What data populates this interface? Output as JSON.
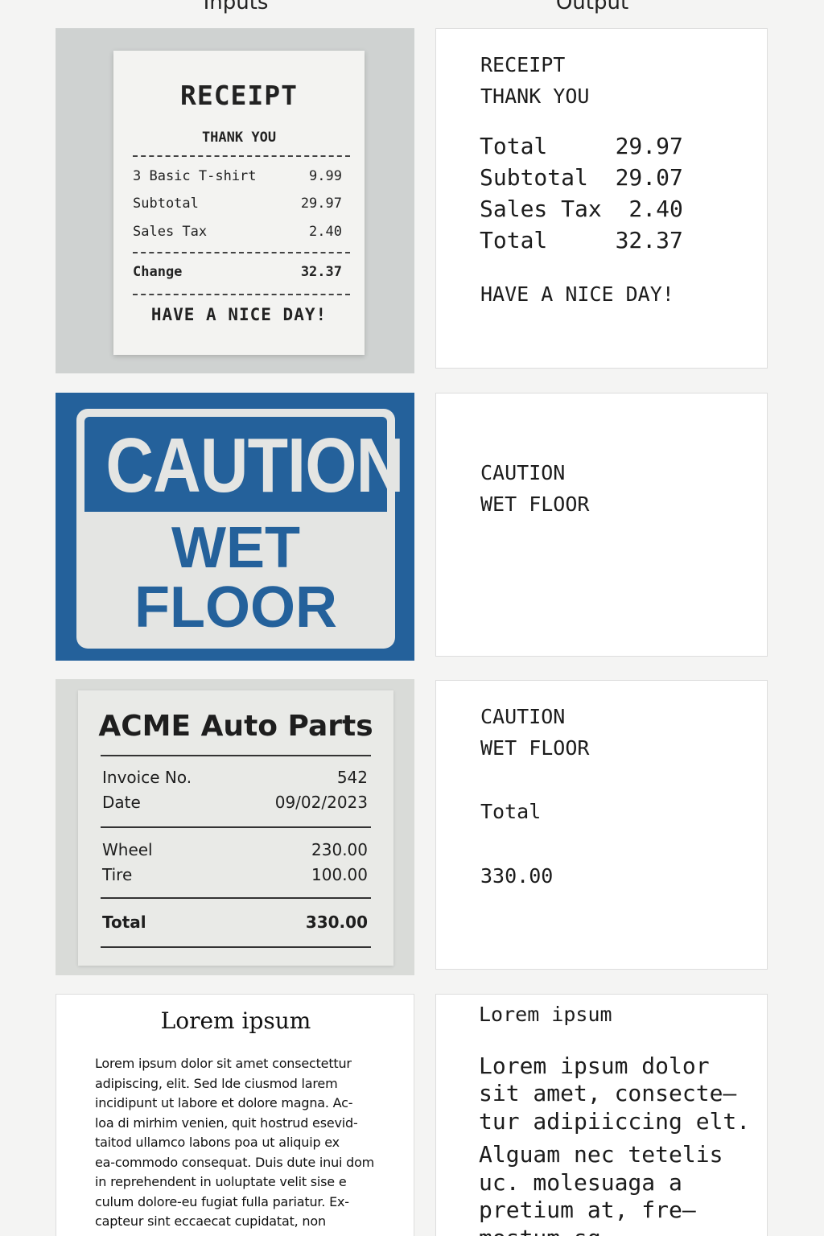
{
  "headers": {
    "inputs": "Inputs",
    "output": "Output"
  },
  "receipt_input": {
    "title": "RECEIPT",
    "subtitle": "THANK YOU",
    "rows": [
      {
        "label": "3 Basic T-shirt",
        "value": "9.99"
      },
      {
        "label": "Subtotal",
        "value": "29.97"
      },
      {
        "label": "Sales Tax",
        "value": "2.40"
      }
    ],
    "change": {
      "label": "Change",
      "value": "32.37"
    },
    "footer": "HAVE A NICE DAY!"
  },
  "receipt_output": {
    "lines": [
      "RECEIPT",
      "THANK YOU"
    ],
    "rows": [
      "Total     29.97",
      "Subtotal  29.07",
      "Sales Tax  2.40",
      "Total     32.37"
    ],
    "footer": "HAVE A NICE DAY!"
  },
  "sign_input": {
    "line1": "CAUTION",
    "line2": "WET",
    "line3": "FLOOR",
    "colors": {
      "blue": "#24619b",
      "light": "#e4e5e3"
    }
  },
  "sign_output": {
    "lines": [
      "CAUTION",
      "WET FLOOR"
    ]
  },
  "invoice_input": {
    "title": "ACME Auto Parts",
    "invoice_no": {
      "label": "Invoice No.",
      "value": "542"
    },
    "date": {
      "label": "Date",
      "value": "09/02/2023"
    },
    "items": [
      {
        "label": "Wheel",
        "value": "230.00"
      },
      {
        "label": "Tire",
        "value": "100.00"
      }
    ],
    "total": {
      "label": "Total",
      "value": "330.00"
    }
  },
  "invoice_output": {
    "lines": [
      "CAUTION",
      "WET FLOOR"
    ],
    "total_label": "Total",
    "total_value": "330.00"
  },
  "lorem_input": {
    "title": "Lorem ipsum",
    "body_lines": [
      "Lorem ipsum dolor sit amet consectettur",
      "adipiscing, elit. Sed lde ciusmod larem",
      "incidipunt ut labore et dolore magna. Ac-",
      "loa di mirhim venien, quit hostrud esevid-",
      "taitod ullamco labons poa ut aliquip ex",
      "ea-commodo consequat. Duis dute inui dom",
      "in reprehendent in uoluptate velit sise e",
      "culum dolore-eu fugiat fulla pariatur. Ex-",
      "capteur sint eccaecat cupidatat, non"
    ]
  },
  "lorem_output": {
    "title": "Lorem ipsum",
    "lines": [
      "Lorem ipsum dolor",
      "sit amet, consecte–",
      "tur adipiiccing elt.",
      "Alguam nec tetelis",
      "uc. molesuaga a",
      "pretium at, fre–",
      "mostum sg"
    ]
  }
}
